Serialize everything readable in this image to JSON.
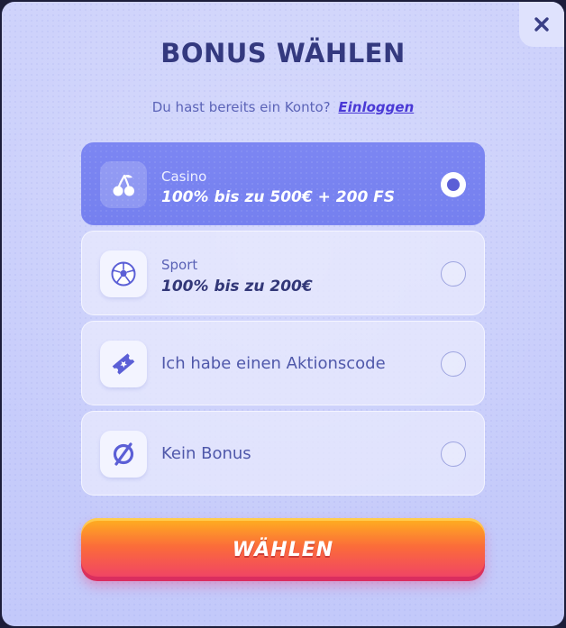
{
  "modal": {
    "title": "BONUS WÄHLEN",
    "subtitle": "Du hast bereits ein Konto?",
    "login_link": "Einloggen",
    "close_icon": "close-icon"
  },
  "options": [
    {
      "id": "casino",
      "label": "Casino",
      "offer": "100% bis zu 500€ + 200 FS",
      "icon": "cherry-icon",
      "selected": true
    },
    {
      "id": "sport",
      "label": "Sport",
      "offer": "100% bis zu 200€",
      "icon": "soccer-ball-icon",
      "selected": false
    },
    {
      "id": "promo",
      "label": "Ich habe einen Aktionscode",
      "icon": "ticket-icon",
      "selected": false
    },
    {
      "id": "none",
      "label": "Kein Bonus",
      "icon": "no-bonus-icon",
      "selected": false
    }
  ],
  "cta": {
    "label": "WÄHLEN"
  },
  "colors": {
    "accent": "#7580ef",
    "title": "#34397f",
    "link": "#4a39d6",
    "cta_top": "#ffb21e",
    "cta_bottom": "#ef3f6a"
  }
}
